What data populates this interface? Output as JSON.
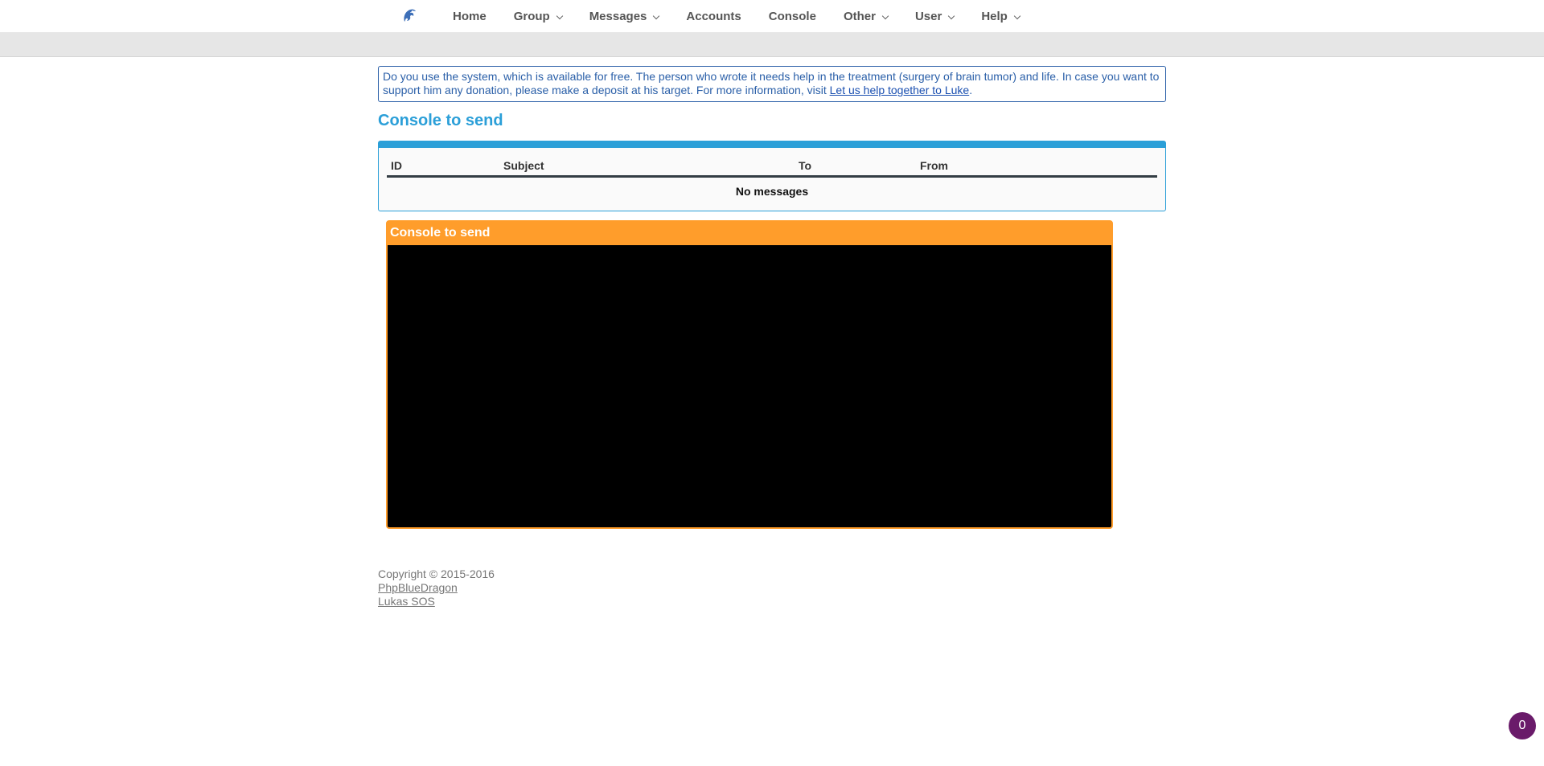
{
  "nav": {
    "logo_icon": "dragon-logo-icon",
    "items": [
      {
        "label": "Home",
        "dropdown": false
      },
      {
        "label": "Group",
        "dropdown": true
      },
      {
        "label": "Messages",
        "dropdown": true
      },
      {
        "label": "Accounts",
        "dropdown": false
      },
      {
        "label": "Console",
        "dropdown": false
      },
      {
        "label": "Other",
        "dropdown": true
      },
      {
        "label": "User",
        "dropdown": true
      },
      {
        "label": "Help",
        "dropdown": true
      }
    ]
  },
  "notice": {
    "text": "Do you use the system, which is available for free. The person who wrote it needs help in the treatment (surgery of brain tumor) and life. In case you want to support him any donation, please make a deposit at his target. For more information, visit ",
    "link_text": "Let us help together to Luke",
    "suffix": "."
  },
  "page": {
    "title": "Console to send"
  },
  "messages_table": {
    "columns": [
      "ID",
      "Subject",
      "To",
      "From"
    ],
    "empty_text": "No messages"
  },
  "console": {
    "title": "Console to send"
  },
  "footer": {
    "copyright": "Copyright © 2015-2016",
    "link1": "PhpBlueDragon",
    "link2": "Lukas SOS"
  },
  "badge": {
    "count": "0"
  },
  "colors": {
    "accent_blue": "#2b9fd8",
    "console_orange": "#ff9d2b",
    "badge_purple": "#6a1b6a"
  }
}
